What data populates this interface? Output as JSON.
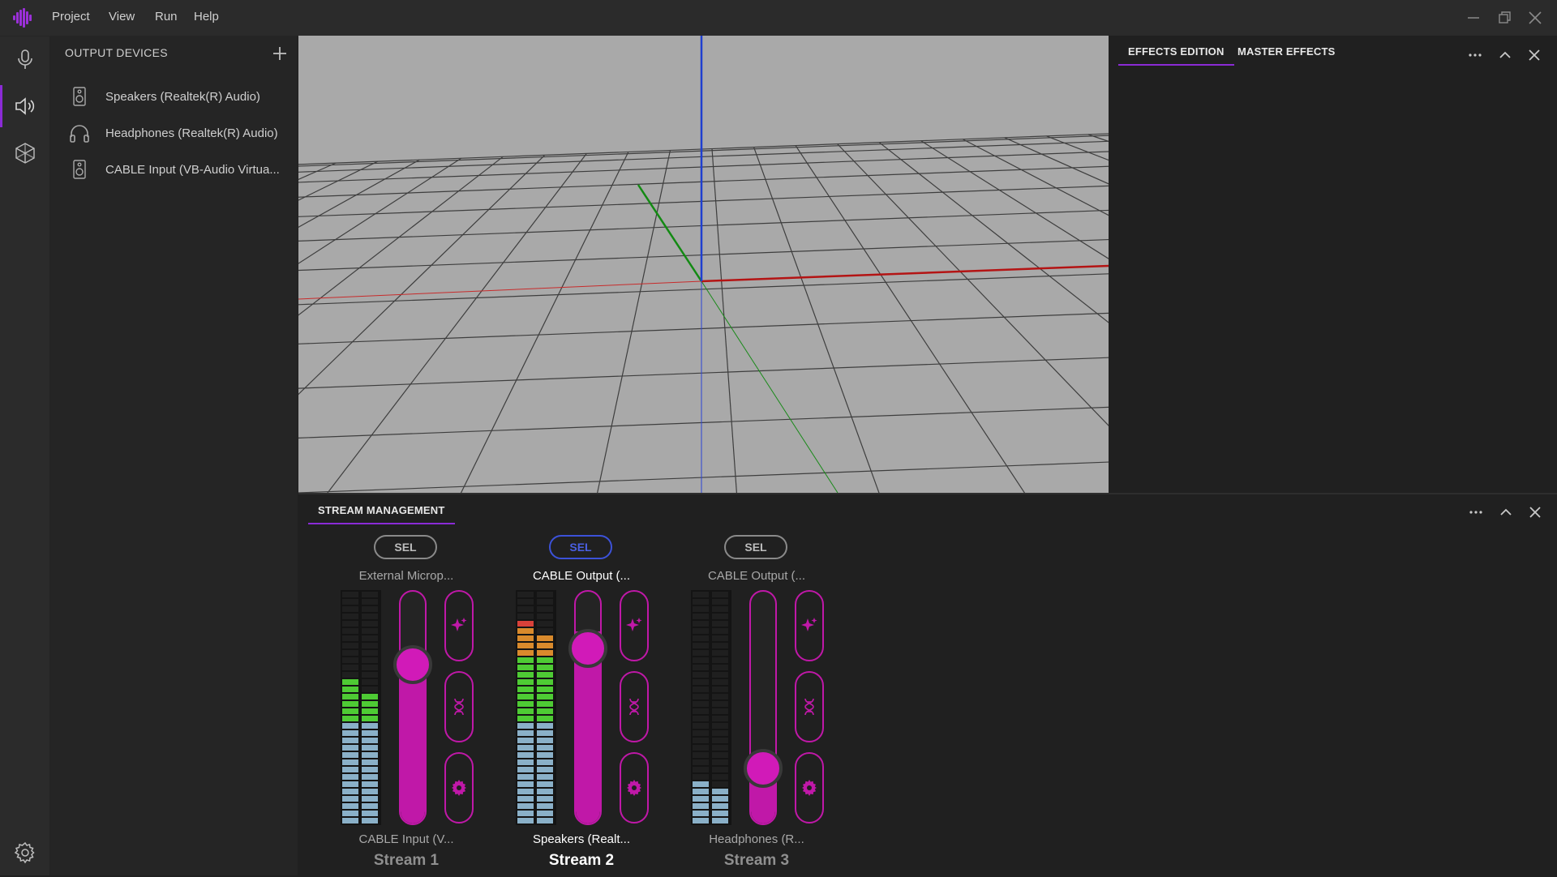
{
  "menu": [
    "Project",
    "View",
    "Run",
    "Help"
  ],
  "devices_panel": {
    "title": "OUTPUT DEVICES",
    "devices": [
      {
        "label": "Speakers (Realtek(R) Audio)",
        "icon": "speaker-icon"
      },
      {
        "label": "Headphones (Realtek(R) Audio)",
        "icon": "headphones-icon"
      },
      {
        "label": "CABLE Input (VB-Audio Virtua...",
        "icon": "speaker-icon"
      }
    ]
  },
  "effects_panel": {
    "tabs": [
      "EFFECTS EDITION",
      "MASTER EFFECTS"
    ],
    "active_tab": 0
  },
  "stream_panel": {
    "tab": "STREAM MANAGEMENT",
    "streams": [
      {
        "sel_label": "SEL",
        "input": "External Microp...",
        "output": "CABLE Input (V...",
        "name": "Stream 1",
        "selected": false,
        "volume": 0.75,
        "meter_left": 0.61,
        "meter_right": 0.56
      },
      {
        "sel_label": "SEL",
        "input": "CABLE Output (...",
        "output": "Speakers (Realt...",
        "name": "Stream 2",
        "selected": true,
        "volume": 0.83,
        "meter_left": 0.86,
        "meter_right": 0.8
      },
      {
        "sel_label": "SEL",
        "input": "CABLE Output (...",
        "output": "Headphones (R...",
        "name": "Stream 3",
        "selected": false,
        "volume": 0.25,
        "meter_left": 0.2,
        "meter_right": 0.16
      }
    ]
  },
  "colors": {
    "accent": "#8b2bd6",
    "fader": "#c018a8",
    "sel_active": "#3c52d9",
    "meter_blue": "#8ab0c8",
    "meter_green": "#4ecb34",
    "meter_orange": "#d98a2c",
    "meter_red": "#d8413a",
    "axis_x": "#b41414",
    "axis_y": "#1f3fd0",
    "axis_z": "#138a13"
  }
}
